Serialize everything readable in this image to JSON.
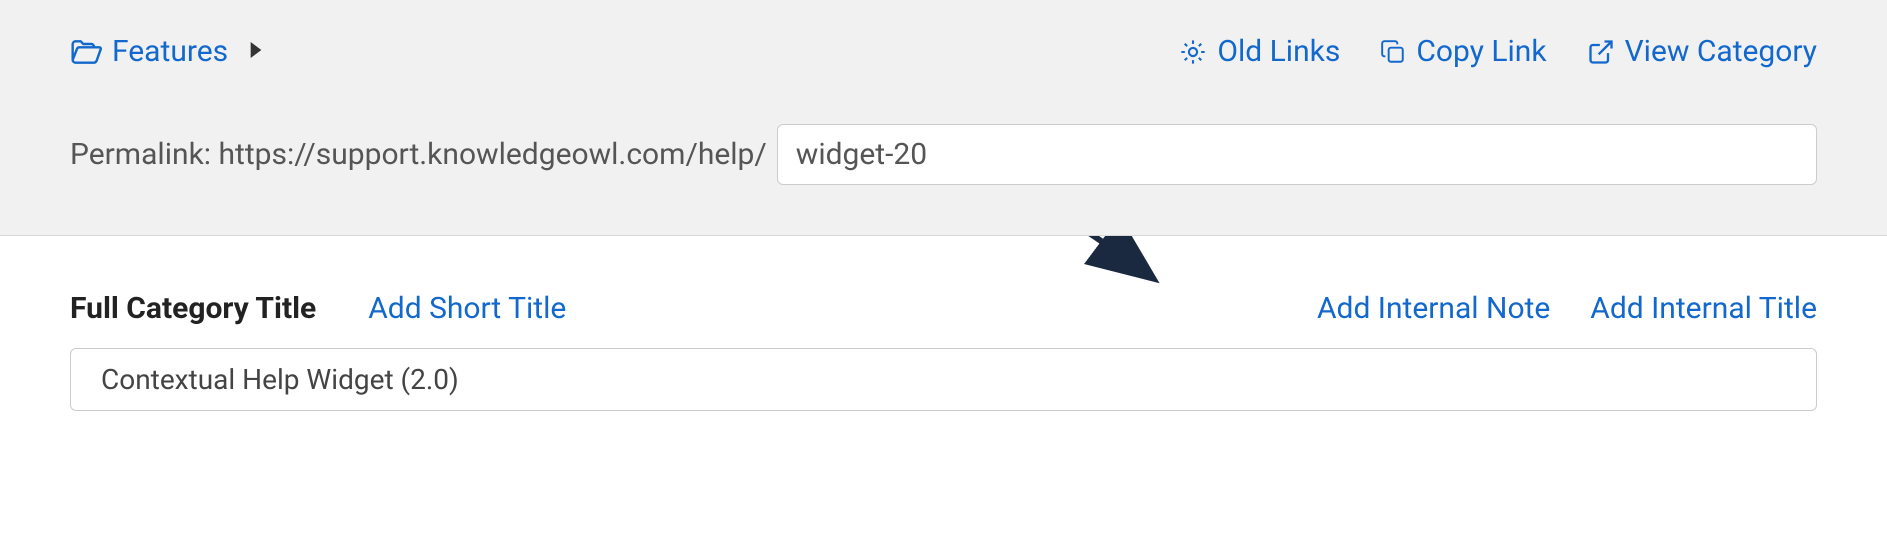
{
  "breadcrumb": {
    "label": "Features"
  },
  "actions": {
    "old_links": "Old Links",
    "copy_link": "Copy Link",
    "view_category": "View Category"
  },
  "permalink": {
    "label": "Permalink: https://support.knowledgeowl.com/help/",
    "value": "widget-20"
  },
  "title_section": {
    "full_title_label": "Full Category Title",
    "add_short_title": "Add Short Title",
    "add_internal_note": "Add Internal Note",
    "add_internal_title": "Add Internal Title",
    "title_value": "Contextual Help Widget (2.0)"
  }
}
